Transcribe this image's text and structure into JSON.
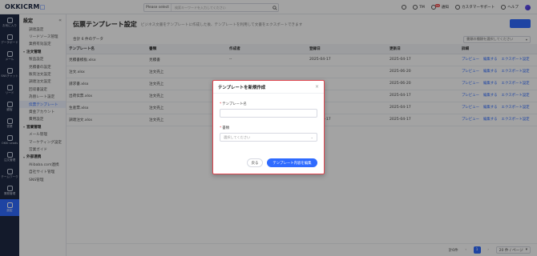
{
  "topbar": {
    "logo_main": "OKKICRM",
    "logo_sub": "□",
    "search_select": "Please select",
    "search_placeholder": "検索キーワードを入力してください",
    "user": "TM",
    "notice": "通知",
    "notice_badge": "99",
    "support": "カスタマーサポート",
    "help": "ヘルプ"
  },
  "rail": [
    {
      "label": "お気に入り"
    },
    {
      "label": "データボード"
    },
    {
      "label": "メール"
    },
    {
      "label": "SNSチャット"
    },
    {
      "label": "リード"
    },
    {
      "label": "顧客"
    },
    {
      "label": "営業"
    },
    {
      "label": "OKKI Leads"
    },
    {
      "label": "注文管理"
    },
    {
      "label": "チームワーク"
    },
    {
      "label": "業務管理"
    },
    {
      "label": "設定"
    }
  ],
  "subside": {
    "title": "設定",
    "items_top": [
      "調達設定",
      "リードソース管理",
      "業務有効設定"
    ],
    "group1": "注文管理",
    "group1_items": [
      "製品設定",
      "見積書の設定",
      "販売注文設定",
      "調達注文設定",
      "回収書設定",
      "為替レート設定",
      "伝票テンプレート",
      "資金アカウント",
      "費用設定"
    ],
    "group2": "営業管理",
    "group2_items": [
      "メール管理",
      "マーケティング設定",
      "営業ガイド"
    ],
    "group3": "外部連携",
    "group3_items": [
      "Alibaba.com連携",
      "自社サイト管理",
      "SNS管理"
    ]
  },
  "main": {
    "title": "伝票テンプレート設定",
    "desc": "ビジネス文書をテンプレートに作成した後、テンプレートを利用して文書をエクスポートできます",
    "count": "合計 6 件のデータ",
    "filter_placeholder": "書類の種類を選択してください",
    "columns": [
      "テンプレート名",
      "書類",
      "作成者",
      "登録日",
      "更新日",
      "詳細"
    ],
    "rows": [
      {
        "name": "見積書模板.xlsx",
        "doc": "見積書",
        "author": "--",
        "created": "2025-04-17",
        "updated": "2025-04-17"
      },
      {
        "name": "注文.xlsx",
        "doc": "注文売上",
        "author": "",
        "created": "",
        "updated": "2025-06-20"
      },
      {
        "name": "請求書.xlsx",
        "doc": "注文売上",
        "author": "",
        "created": "",
        "updated": "2025-06-20"
      },
      {
        "name": "出荷伝票.xlsx",
        "doc": "注文売上",
        "author": "",
        "created": "",
        "updated": "2025-04-17"
      },
      {
        "name": "生産票.xlsx",
        "doc": "注文売上",
        "author": "",
        "created": "",
        "updated": "2025-04-17"
      },
      {
        "name": "調達注文.xlsx",
        "doc": "注文売上",
        "author": "",
        "created": "2025-04-17",
        "updated": "2025-04-17"
      }
    ],
    "ops": [
      "プレビュー",
      "編集する",
      "エクスポート設定"
    ],
    "pager_total": "計6件",
    "pager_current": "1",
    "pager_size": "20 件 / ページ"
  },
  "modal": {
    "title": "テンプレートを新規作成",
    "name_label": "テンプレート名",
    "name_value": "",
    "type_label": "書類",
    "type_placeholder": "選択してください",
    "cancel": "戻る",
    "confirm": "テンプレート内容を編集"
  }
}
